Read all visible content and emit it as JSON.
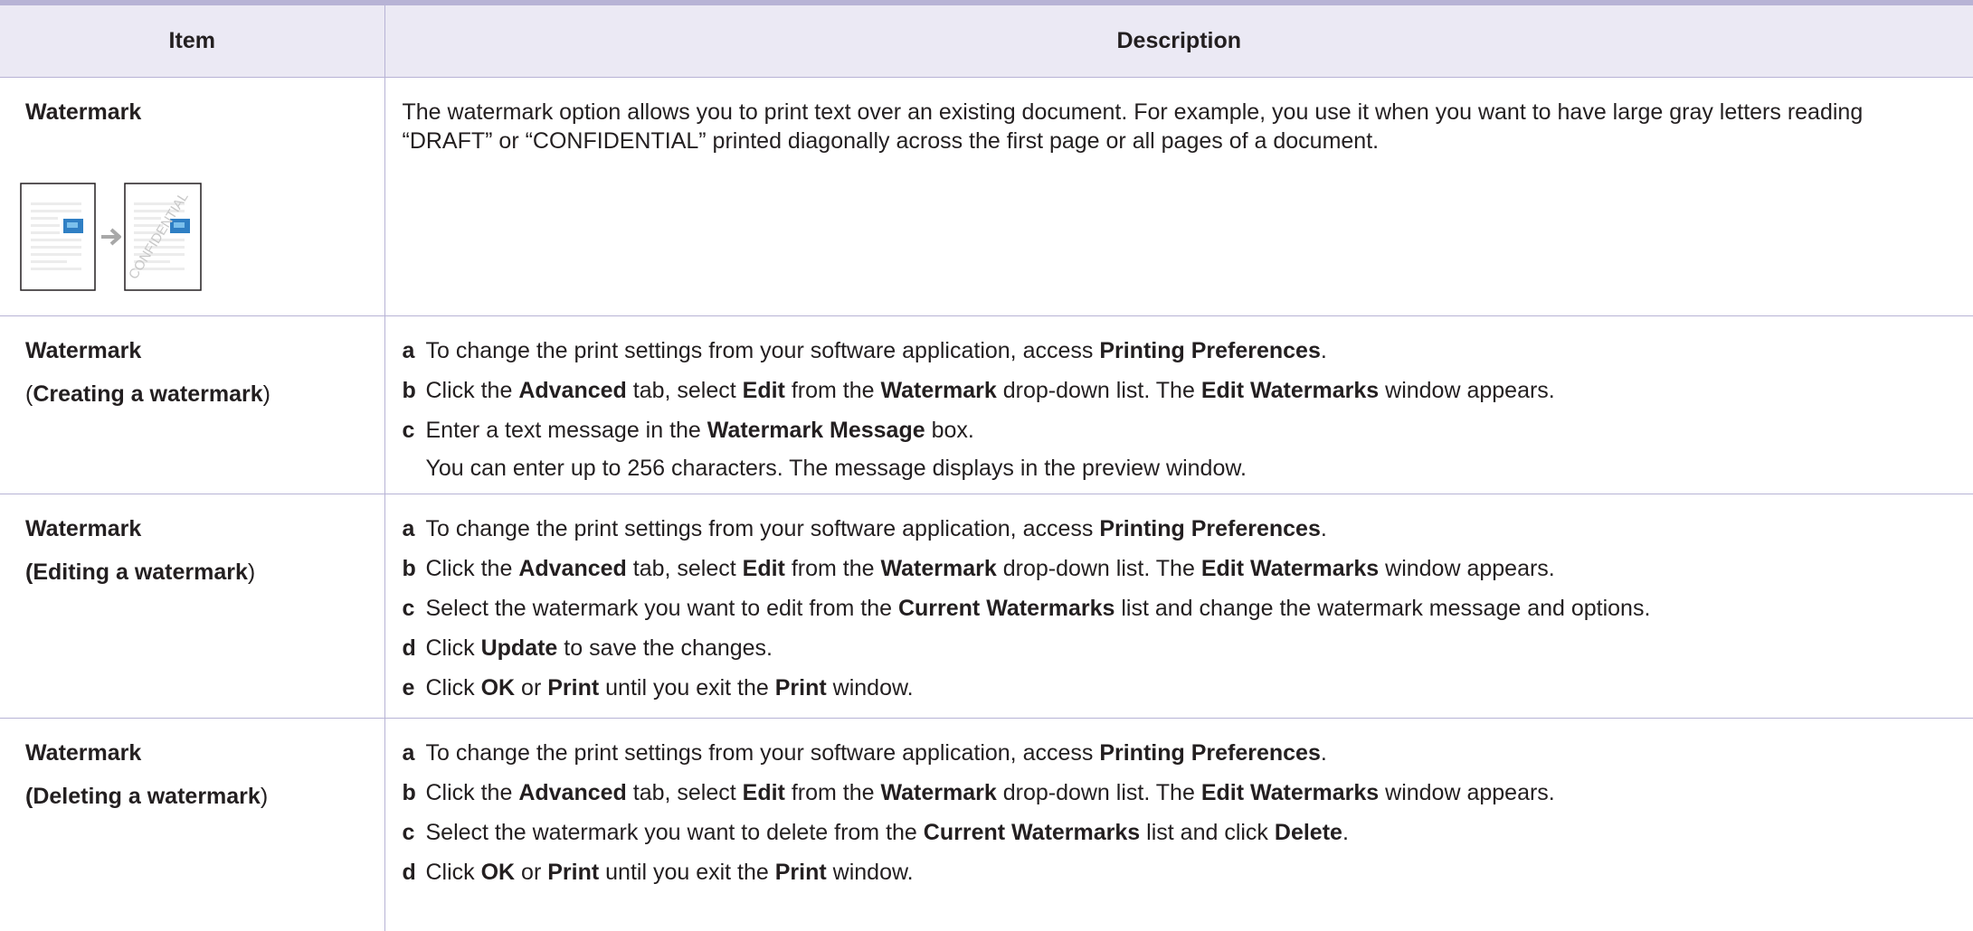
{
  "table": {
    "header": {
      "item": "Item",
      "description": "Description"
    },
    "rows": [
      {
        "item_title": "Watermark",
        "description": "The watermark option allows you to print text over an existing document. For example, you use it when you want to have large gray letters reading “DRAFT” or “CONFIDENTIAL” printed diagonally across the first page or all pages of a document."
      },
      {
        "item_title": "Watermark",
        "item_sub_open": "(",
        "item_sub_bold": "Creating a watermark",
        "item_sub_close": ")",
        "steps": [
          {
            "letter": "a",
            "parts": [
              "To change the print settings from your software application, access ",
              "Printing Preferences",
              "."
            ]
          },
          {
            "letter": "b",
            "parts": [
              "Click the ",
              "Advanced",
              " tab, select ",
              "Edit",
              " from the ",
              "Watermark",
              " drop-down list. The ",
              "Edit Watermarks",
              " window appears."
            ]
          },
          {
            "letter": "c",
            "parts": [
              "Enter a text message in the ",
              "Watermark Message",
              " box."
            ],
            "continuation": "You can enter up to 256 characters. The message displays in the preview window."
          }
        ]
      },
      {
        "item_title": "Watermark",
        "item_sub_bold": "(Editing a watermark",
        "item_sub_close": ")",
        "steps": [
          {
            "letter": "a",
            "parts": [
              "To change the print settings from your software application, access ",
              "Printing Preferences",
              "."
            ]
          },
          {
            "letter": "b",
            "parts": [
              "Click the ",
              "Advanced",
              " tab, select ",
              "Edit",
              " from the ",
              "Watermark",
              " drop-down list. The ",
              "Edit Watermarks",
              " window appears."
            ]
          },
          {
            "letter": "c",
            "parts": [
              "Select the watermark you want to edit from the ",
              "Current Watermarks",
              " list and change the watermark message and options."
            ]
          },
          {
            "letter": "d",
            "parts": [
              "Click ",
              "Update",
              " to save the changes."
            ]
          },
          {
            "letter": "e",
            "parts": [
              "Click ",
              "OK",
              " or ",
              "Print",
              " until you exit the ",
              "Print",
              " window."
            ]
          }
        ]
      },
      {
        "item_title": "Watermark",
        "item_sub_bold": "(Deleting a watermark",
        "item_sub_close": ")",
        "steps": [
          {
            "letter": "a",
            "parts": [
              "To change the print settings from your software application, access ",
              "Printing Preferences",
              "."
            ]
          },
          {
            "letter": "b",
            "parts": [
              "Click the ",
              "Advanced",
              " tab, select ",
              "Edit",
              " from the ",
              "Watermark",
              " drop-down list. The ",
              "Edit Watermarks",
              " window appears."
            ]
          },
          {
            "letter": "c",
            "parts": [
              "Select the watermark you want to delete from the ",
              "Current Watermarks",
              " list and click ",
              "Delete",
              "."
            ]
          },
          {
            "letter": "d",
            "parts": [
              "Click ",
              "OK",
              " or ",
              "Print",
              " until you exit the ",
              "Print",
              " window."
            ]
          }
        ]
      }
    ]
  },
  "illustration": {
    "watermark_text": "CONFIDENTIAL",
    "arrow_icon": "arrow-right-icon",
    "image_color": "#2f7fc4",
    "watermark_color": "#c8c8c8"
  },
  "colors": {
    "header_bg": "#ebe9f4",
    "rule": "#b7b3d5",
    "text": "#231f20"
  }
}
